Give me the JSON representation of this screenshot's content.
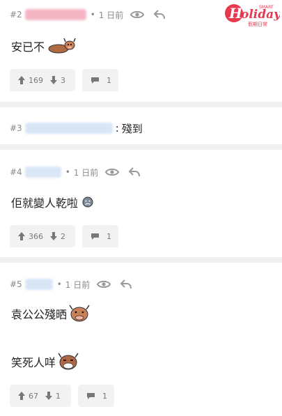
{
  "brand": {
    "logo_text": "Holiday",
    "logo_small": "SMART",
    "logo_cn": "假期日常",
    "color": "#e8384f"
  },
  "posts": [
    {
      "number": "#2",
      "time": "1 日前",
      "lines": [
        "安已不"
      ],
      "upvotes": "169",
      "downvotes": "3",
      "replies": "1"
    },
    {
      "number": "#3",
      "comment": "殘到"
    },
    {
      "number": "#4",
      "time": "1 日前",
      "lines": [
        "佢就變人乾啦"
      ],
      "upvotes": "366",
      "downvotes": "2",
      "replies": "1"
    },
    {
      "number": "#5",
      "time": "1 日前",
      "lines": [
        "袁公公殘晒",
        "笑死人咩"
      ],
      "upvotes": "67",
      "downvotes": "1",
      "replies": "1"
    }
  ],
  "icons": {
    "seen": "eye-icon",
    "reply": "reply-arrow-icon",
    "upvote": "arrow-up-icon",
    "downvote": "arrow-down-icon",
    "comment": "speech-bubble-icon"
  },
  "colors": {
    "meta_text": "#8a8a8a",
    "button_bg": "#f2f2f2",
    "separator": "#f0f0f0",
    "username_blur": "#f4b6c3"
  }
}
